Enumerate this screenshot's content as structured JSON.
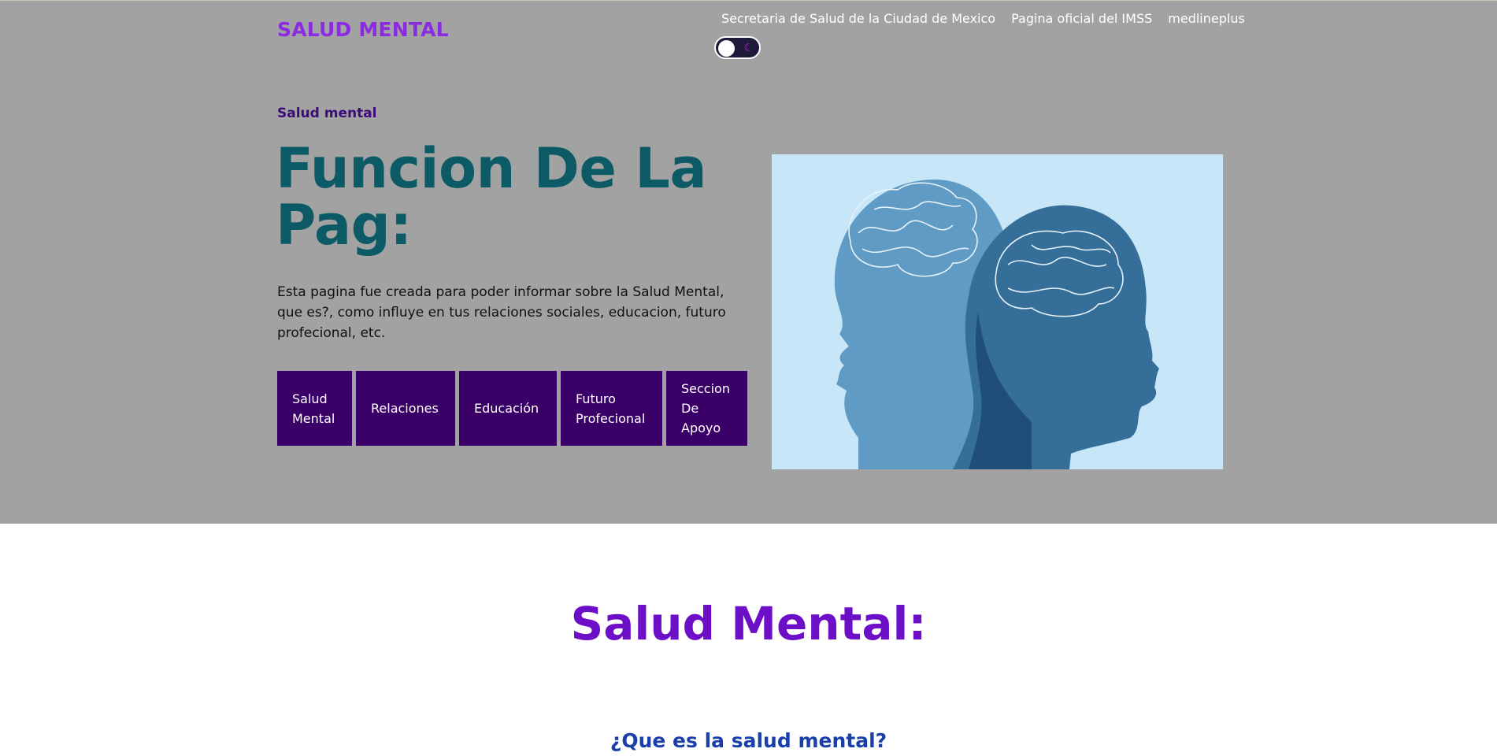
{
  "header": {
    "brand": "SALUD MENTAL",
    "nav": [
      "Secretaria de Salud de la Ciudad de Mexico",
      "Pagina oficial del IMSS",
      "medlineplus"
    ],
    "theme_toggle_icon": "moon-icon"
  },
  "hero": {
    "eyebrow": "Salud mental",
    "title": "Funcion De La Pag:",
    "description": "Esta pagina fue creada para poder informar sobre la Salud Mental, que es?, como influye en tus relaciones sociales, educacion, futuro profecional, etc.",
    "buttons": [
      "Salud Mental",
      "Relaciones",
      "Educación",
      "Futuro Profecional",
      "Seccion De Apoyo"
    ],
    "image_icon": "heads-brain-illustration"
  },
  "section": {
    "title": "Salud Mental:",
    "subtitle": "¿Que es la salud mental?"
  },
  "colors": {
    "hero_bg": "#a2a2a2",
    "brand": "#8a2be2",
    "hero_title": "#0c5a66",
    "button_bg": "#3a0068",
    "section_title": "#6e0fc8",
    "subtitle": "#1a3fa8"
  }
}
